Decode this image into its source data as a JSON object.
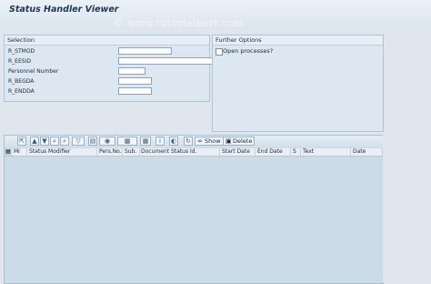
{
  "title": "Status Handler Viewer",
  "watermark": "© www.tutorialkart.com",
  "selection": {
    "title": "Selection",
    "fields": [
      {
        "label": "R_STMOD",
        "value": ""
      },
      {
        "label": "R_EESID",
        "value": ""
      },
      {
        "label": "Personnel Number",
        "value": ""
      },
      {
        "label": "R_BEGDA",
        "value": ""
      },
      {
        "label": "R_ENDDA",
        "value": ""
      }
    ]
  },
  "further_options": {
    "title": "Further Options",
    "open_processes_label": "Open processes?",
    "open_processes_checked": false
  },
  "toolbar": {
    "show_label": "Show",
    "delete_label": "Delete"
  },
  "table": {
    "columns": [
      "Mi",
      "Status Modifier",
      "Pers.No.",
      "Sub.",
      "Document Status Id.",
      "Start Date",
      "End Date",
      "S",
      "Text",
      "Date"
    ]
  },
  "colors": {
    "background": "#dfe6ee",
    "group": "#dce7f1",
    "grid": "#ccdbe8"
  }
}
